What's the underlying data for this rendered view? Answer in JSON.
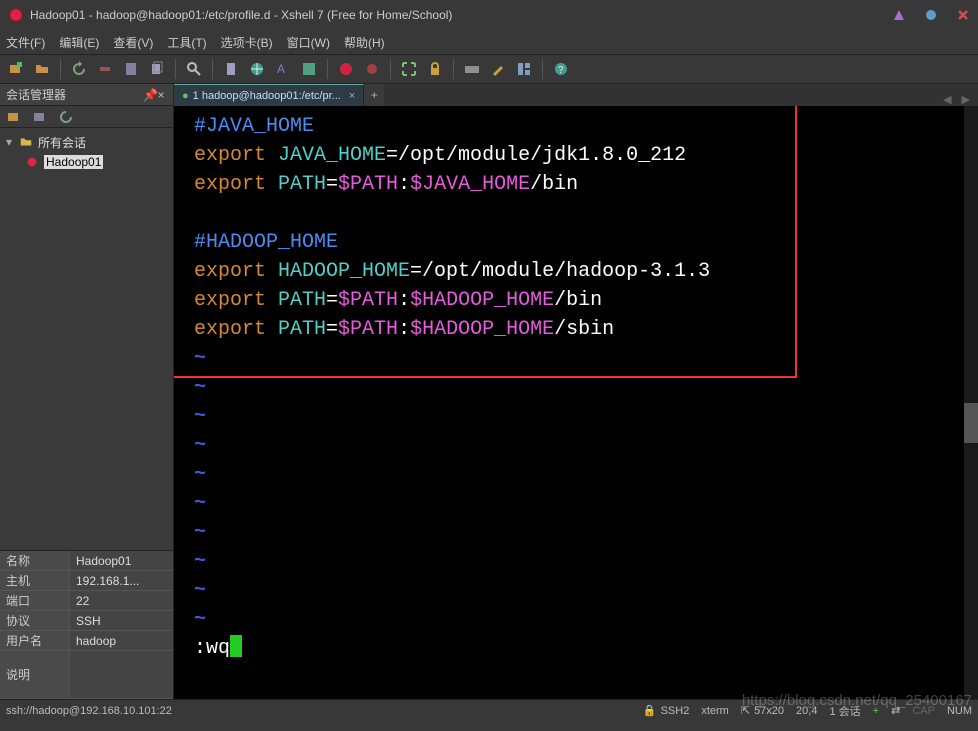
{
  "title": "Hadoop01 - hadoop@hadoop01:/etc/profile.d - Xshell 7 (Free for Home/School)",
  "menu": {
    "file": "文件(F)",
    "edit": "编辑(E)",
    "view": "查看(V)",
    "tools": "工具(T)",
    "tab": "选项卡(B)",
    "window": "窗口(W)",
    "help": "帮助(H)"
  },
  "sidebar": {
    "title": "会话管理器",
    "root": "所有会话",
    "session": "Hadoop01"
  },
  "props": {
    "name_k": "名称",
    "name_v": "Hadoop01",
    "host_k": "主机",
    "host_v": "192.168.1...",
    "port_k": "端口",
    "port_v": "22",
    "proto_k": "协议",
    "proto_v": "SSH",
    "user_k": "用户名",
    "user_v": "hadoop",
    "desc_k": "说明",
    "desc_v": ""
  },
  "tab": {
    "label": "1 hadoop@hadoop01:/etc/pr...",
    "bullet": "●"
  },
  "terminal": {
    "l1_a": "#JAVA_HOME",
    "l2_a": "export ",
    "l2_b": "JAVA_HOME",
    "l2_c": "=/opt/module/jdk1.8.0_212",
    "l3_a": "export ",
    "l3_b": "PATH",
    "l3_c": "=",
    "l3_d": "$PATH",
    "l3_e": ":",
    "l3_f": "$JAVA_HOME",
    "l3_g": "/bin",
    "l5_a": "#HADOOP_HOME",
    "l6_a": "export ",
    "l6_b": "HADOOP_HOME",
    "l6_c": "=/opt/module/hadoop-3.1.3",
    "l7_a": "export ",
    "l7_b": "PATH",
    "l7_c": "=",
    "l7_d": "$PATH",
    "l7_e": ":",
    "l7_f": "$HADOOP_HOME",
    "l7_g": "/bin",
    "l8_a": "export ",
    "l8_b": "PATH",
    "l8_c": "=",
    "l8_d": "$PATH",
    "l8_e": ":",
    "l8_f": "$HADOOP_HOME",
    "l8_g": "/sbin",
    "tilde": "~",
    "cmd": ":wq"
  },
  "status": {
    "conn": "ssh://hadoop@192.168.10.101:22",
    "ssh": "SSH2",
    "term": "xterm",
    "size": "57x20",
    "pos": "20,4",
    "sess": "1 会话",
    "cap": "CAP",
    "num": "NUM"
  },
  "watermark": "https://blog.csdn.net/qq_25400167"
}
